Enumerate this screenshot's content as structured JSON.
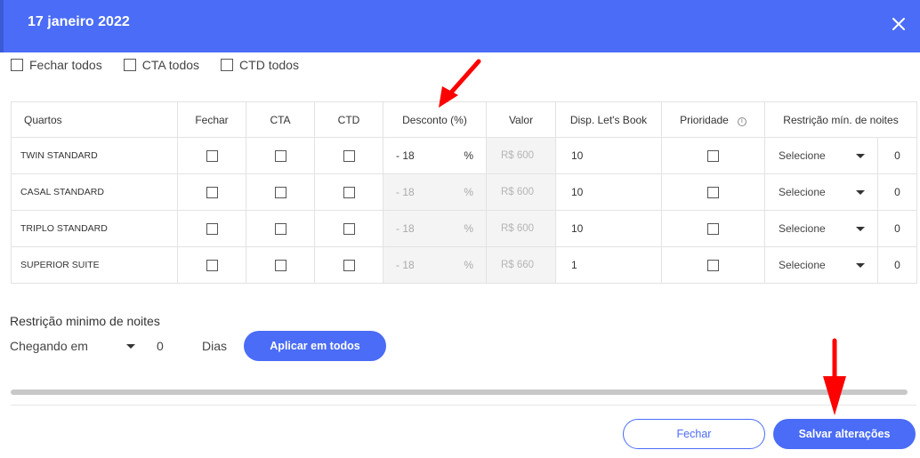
{
  "header": {
    "title": "17 janeiro 2022",
    "close_icon": "close-icon"
  },
  "bulk_checks": [
    {
      "label": "Fechar todos",
      "checked": false
    },
    {
      "label": "CTA todos",
      "checked": false
    },
    {
      "label": "CTD todos",
      "checked": false
    }
  ],
  "table": {
    "columns": [
      "Quartos",
      "Fechar",
      "CTA",
      "CTD",
      "Desconto (%)",
      "Valor",
      "Disp. Let's Book",
      "Prioridade",
      "Restrição mín. de noites"
    ],
    "percent_sign": "%",
    "rows": [
      {
        "name": "TWIN STANDARD",
        "discount": "- 18",
        "value": "R$ 600",
        "disp": "10",
        "select": "Selecione",
        "nights": "0",
        "discount_enabled": true
      },
      {
        "name": "CASAL STANDARD",
        "discount": "- 18",
        "value": "R$ 600",
        "disp": "10",
        "select": "Selecione",
        "nights": "0",
        "discount_enabled": false
      },
      {
        "name": "TRIPLO STANDARD",
        "discount": "- 18",
        "value": "R$ 600",
        "disp": "10",
        "select": "Selecione",
        "nights": "0",
        "discount_enabled": false
      },
      {
        "name": "SUPERIOR SUITE",
        "discount": "- 18",
        "value": "R$ 660",
        "disp": "1",
        "select": "Selecione",
        "nights": "0",
        "discount_enabled": false
      }
    ]
  },
  "restriction": {
    "title": "Restrição minimo de noites",
    "arrival_select": "Chegando em",
    "nights": "0",
    "unit": "Dias",
    "apply_label": "Aplicar em todos"
  },
  "footer": {
    "close_label": "Fechar",
    "save_label": "Salvar alterações"
  },
  "colors": {
    "primary": "#4a6cf7",
    "annotation": "#ff0000"
  }
}
